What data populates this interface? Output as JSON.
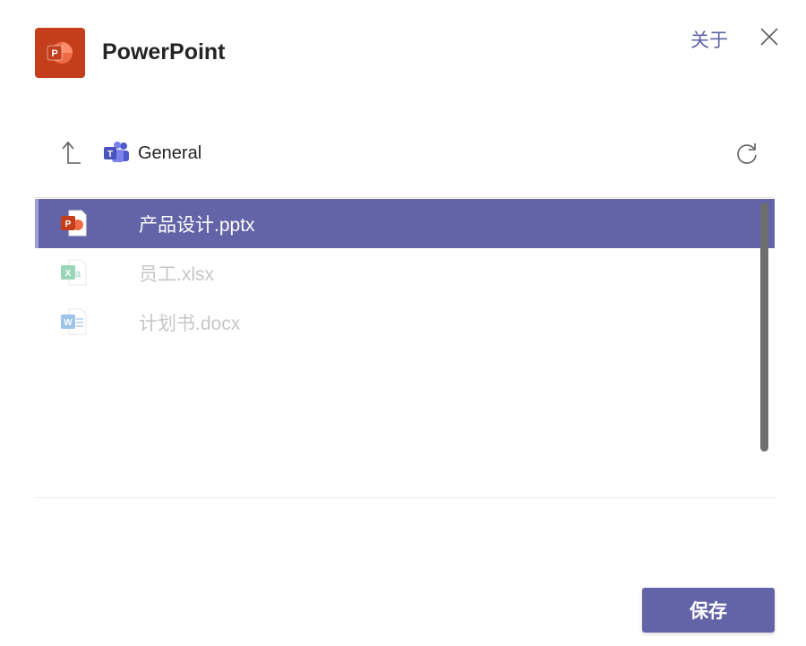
{
  "header": {
    "app_name": "PowerPoint",
    "app_icon": "powerpoint-icon",
    "about_label": "关于",
    "close_icon": "close-icon"
  },
  "navigation": {
    "up_icon": "arrow-up-icon",
    "location_icon": "teams-icon",
    "folder_name": "General",
    "refresh_icon": "refresh-icon"
  },
  "files": [
    {
      "name": "产品设计.pptx",
      "type": "pptx",
      "icon": "powerpoint-file-icon",
      "selected": true
    },
    {
      "name": "员工.xlsx",
      "type": "xlsx",
      "icon": "excel-file-icon",
      "selected": false
    },
    {
      "name": "计划书.docx",
      "type": "docx",
      "icon": "word-file-icon",
      "selected": false
    }
  ],
  "footer": {
    "save_label": "保存"
  },
  "colors": {
    "accent": "#6264a7",
    "powerpoint": "#c43e1c",
    "excel": "#21a366",
    "word": "#2b7cd3"
  }
}
